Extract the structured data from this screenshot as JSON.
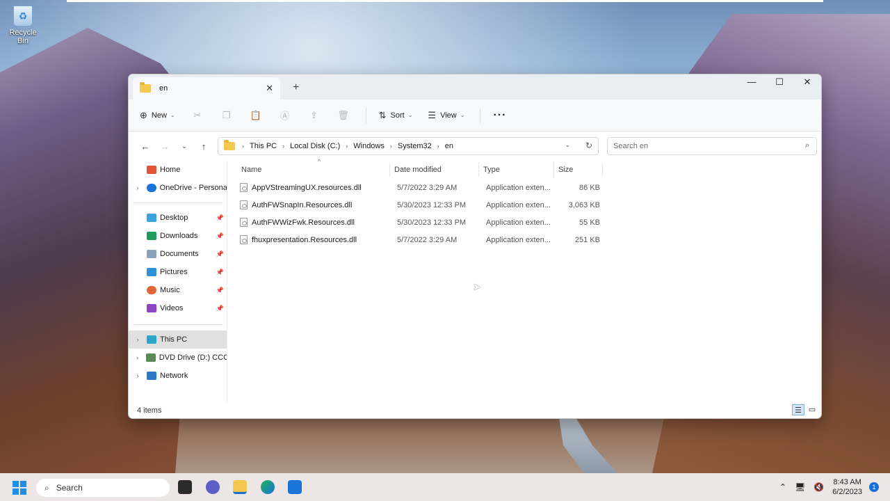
{
  "desktop": {
    "recycle_bin_label": "Recycle Bin"
  },
  "window": {
    "tab_title": "en",
    "new_tab_symbol": "+",
    "close_tab_symbol": "✕",
    "controls": {
      "minimize": "—",
      "maximize": "☐",
      "close": "✕"
    }
  },
  "toolbar": {
    "new_label": "New",
    "sort_label": "Sort",
    "view_label": "View",
    "more_label": "···"
  },
  "address": {
    "crumbs": [
      "This PC",
      "Local Disk (C:)",
      "Windows",
      "System32",
      "en"
    ]
  },
  "search": {
    "placeholder": "Search en"
  },
  "sidebar": {
    "items": [
      {
        "label": "Home",
        "icon": "home-icon",
        "color": "#e2533a"
      },
      {
        "label": "OneDrive - Persona",
        "icon": "cloud-icon",
        "color": "#1a73d8"
      },
      {
        "label": "Desktop",
        "icon": "desktop-icon",
        "color": "#3aa3e0"
      },
      {
        "label": "Downloads",
        "icon": "download-icon",
        "color": "#1f9b5e"
      },
      {
        "label": "Documents",
        "icon": "documents-icon",
        "color": "#8aa2bd"
      },
      {
        "label": "Pictures",
        "icon": "pictures-icon",
        "color": "#2f8fd8"
      },
      {
        "label": "Music",
        "icon": "music-icon",
        "color": "#e0663a"
      },
      {
        "label": "Videos",
        "icon": "videos-icon",
        "color": "#8e44c7"
      },
      {
        "label": "This PC",
        "icon": "pc-icon",
        "color": "#2aa6c9"
      },
      {
        "label": "DVD Drive (D:) CCC",
        "icon": "dvd-icon",
        "color": "#5b8a5a"
      },
      {
        "label": "Network",
        "icon": "network-icon",
        "color": "#2a79c9"
      }
    ]
  },
  "columns": {
    "name": "Name",
    "date": "Date modified",
    "type": "Type",
    "size": "Size"
  },
  "files": [
    {
      "name": "AppVStreamingUX.resources.dll",
      "date": "5/7/2022 3:29 AM",
      "type": "Application exten...",
      "size": "86 KB"
    },
    {
      "name": "AuthFWSnapIn.Resources.dll",
      "date": "5/30/2023 12:33 PM",
      "type": "Application exten...",
      "size": "3,063 KB"
    },
    {
      "name": "AuthFWWizFwk.Resources.dll",
      "date": "5/30/2023 12:33 PM",
      "type": "Application exten...",
      "size": "55 KB"
    },
    {
      "name": "fhuxpresentation.Resources.dll",
      "date": "5/7/2022 3:29 AM",
      "type": "Application exten...",
      "size": "251 KB"
    }
  ],
  "status": {
    "item_count": "4 items"
  },
  "taskbar": {
    "search_label": "Search",
    "time": "8:43 AM",
    "date": "6/2/2023",
    "notification_count": "1"
  }
}
